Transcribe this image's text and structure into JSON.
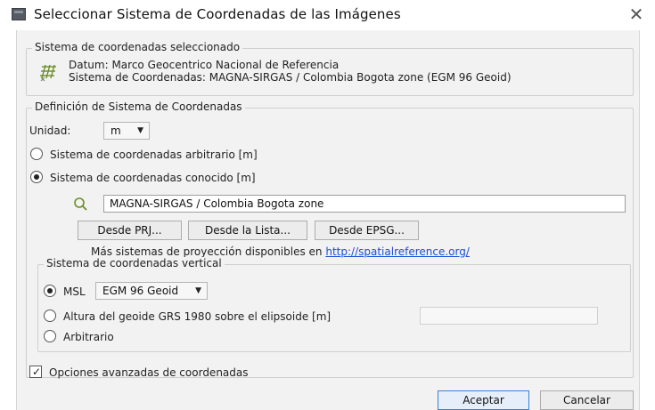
{
  "window": {
    "title": "Seleccionar Sistema de Coordenadas de las Imágenes",
    "close_icon": "✕"
  },
  "selected": {
    "group_title": "Sistema de coordenadas seleccionado",
    "datum_line": "Datum: Marco Geocentrico Nacional de Referencia",
    "system_line": "Sistema de Coordenadas: MAGNA-SIRGAS / Colombia Bogota zone (EGM 96 Geoid)"
  },
  "definition": {
    "group_title": "Definición de Sistema de Coordenadas",
    "unit_label": "Unidad:",
    "unit_value": "m",
    "radio_arbitrary": "Sistema de coordenadas arbitrario [m]",
    "radio_known": "Sistema de coordenadas conocido [m]",
    "search_value": "MAGNA-SIRGAS / Colombia Bogota zone",
    "btn_prj": "Desde PRJ...",
    "btn_list": "Desde la Lista...",
    "btn_epsg": "Desde EPSG...",
    "more_text": "Más sistemas de proyección disponibles en",
    "more_link": "http://spatialreference.org/"
  },
  "vertical": {
    "group_title": "Sistema de coordenadas vertical",
    "radio_msl": "MSL",
    "msl_value": "EGM 96 Geoid",
    "radio_geoid": "Altura del geoide GRS 1980 sobre el elipsoide [m]",
    "geoid_value": "",
    "radio_arbitrary": "Arbitrario"
  },
  "advanced": {
    "label": "Opciones avanzadas de coordenadas",
    "checked": true
  },
  "footer": {
    "ok_label": "Aceptar",
    "cancel_label": "Cancelar"
  },
  "colors": {
    "link": "#1a4fd6",
    "primary_border": "#3c7fd1",
    "dialog_bg": "#f2f2f2"
  }
}
